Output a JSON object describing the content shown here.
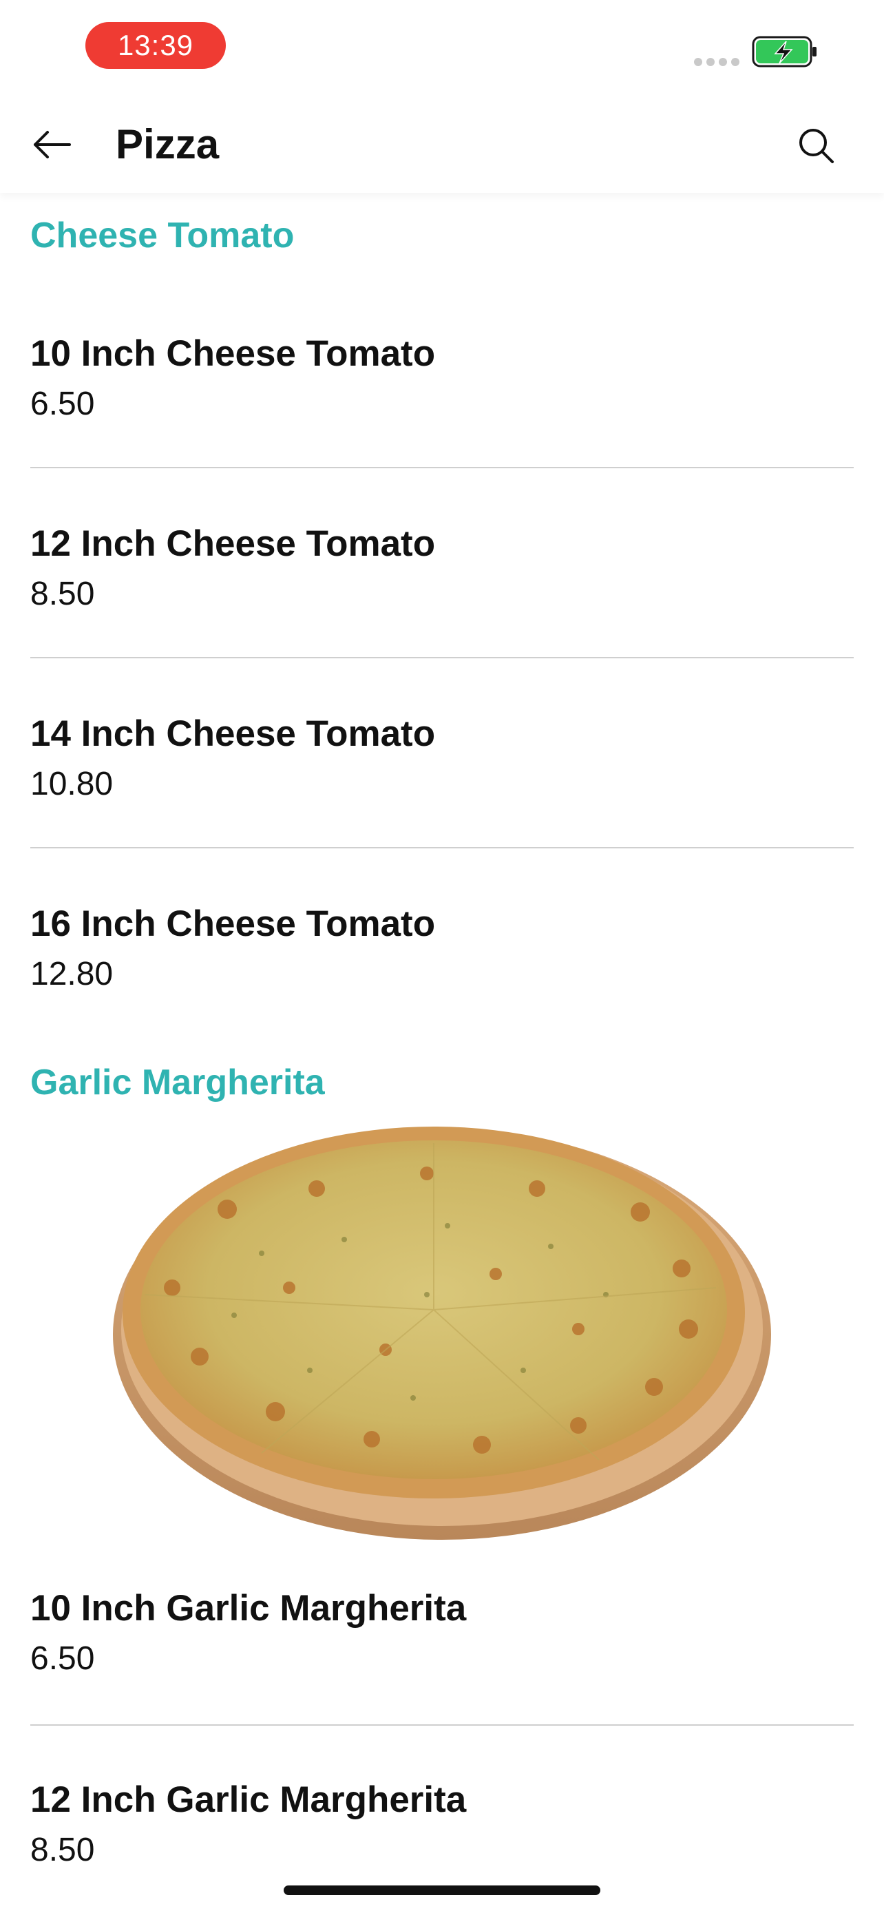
{
  "status_bar": {
    "time": "13:39"
  },
  "header": {
    "title": "Pizza",
    "back_icon": "arrow-left-icon",
    "search_icon": "search-icon"
  },
  "sections": [
    {
      "heading": "Cheese Tomato",
      "items": [
        {
          "name": "10 Inch Cheese Tomato",
          "price": "6.50"
        },
        {
          "name": "12 Inch Cheese Tomato",
          "price": "8.50"
        },
        {
          "name": "14 Inch Cheese Tomato",
          "price": "10.80"
        },
        {
          "name": "16 Inch Cheese Tomato",
          "price": "12.80"
        }
      ]
    },
    {
      "heading": "Garlic Margherita",
      "image": "pizza-photo",
      "items": [
        {
          "name": "10 Inch Garlic Margherita",
          "price": "6.50"
        },
        {
          "name": "12 Inch Garlic Margherita",
          "price": "8.50"
        }
      ]
    }
  ],
  "colors": {
    "accent": "#2fb3b1",
    "time_pill": "#ef3b33",
    "battery": "#33c759"
  }
}
